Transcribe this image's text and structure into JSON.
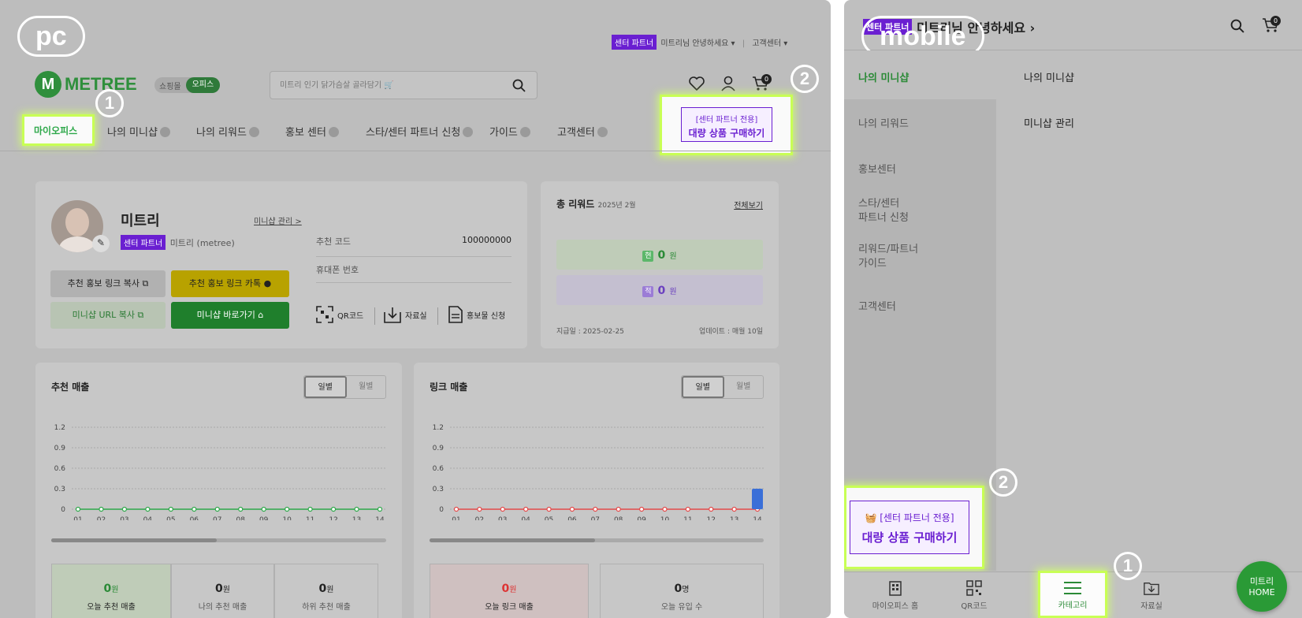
{
  "pc": {
    "tag": "pc",
    "top_bar": {
      "badge": "센터 파트너",
      "greeting": "미트리님 안녕하세요 ▾",
      "customer_center": "고객센터 ▾"
    },
    "logo_text": "METREE",
    "mall_toggle": {
      "shop": "쇼핑몰",
      "office": "오피스"
    },
    "search_placeholder": "미트리 인기 닭가슴살 골라담기 🛒",
    "cart_count": "0",
    "marker1": "1",
    "marker2": "2",
    "nav": [
      "마이오피스",
      "나의 미니샵",
      "나의 리워드",
      "홍보 센터",
      "스타/센터 파트너 신청",
      "가이드",
      "고객센터"
    ],
    "bulk": {
      "line1": "[센터 파트너 전용]",
      "line2": "대량 상품 구매하기"
    },
    "profile": {
      "name": "미트리",
      "manage_link": "미니샵 관리 >",
      "badge": "센터 파트너",
      "sub": "미트리 (metree)",
      "code_label": "추천 코드",
      "code_value": "100000000",
      "phone_label": "휴대폰 번호",
      "buttons": [
        "추천 홍보 링크 복사",
        "추천 홍보 링크 카톡",
        "미니샵 URL 복사",
        "미니샵 바로가기"
      ],
      "shortcuts": [
        "QR코드",
        "자료실",
        "홍보물 신청"
      ]
    },
    "reward": {
      "title": "총 리워드",
      "period": "2025년 2월",
      "all_link": "전체보기",
      "row1_badge": "현",
      "row1_value": "0",
      "row1_unit": "원",
      "row2_badge": "적",
      "row2_value": "0",
      "row2_unit": "원",
      "pay_date": "지급일 : 2025-02-25",
      "update": "업데이트 : 매월 10일"
    },
    "sales_cards": [
      {
        "title": "추천 매출",
        "tabs": [
          "일별",
          "월별"
        ],
        "stats": [
          {
            "value": "0",
            "unit": "원",
            "label": "오늘 추천 매출"
          },
          {
            "value": "0",
            "unit": "원",
            "label": "나의 추천 매출"
          },
          {
            "value": "0",
            "unit": "원",
            "label": "하위 추천 매출"
          }
        ]
      },
      {
        "title": "링크 매출",
        "tabs": [
          "일별",
          "월별"
        ],
        "stats": [
          {
            "value": "0",
            "unit": "원",
            "label": "오늘 링크 매출"
          },
          {
            "value": "0",
            "unit": "명",
            "label": "오늘 유입 수"
          }
        ]
      }
    ]
  },
  "mobile": {
    "tag": "mobile",
    "header": {
      "badge": "센터 파트너",
      "greeting": "미트리님 안녕하세요",
      "cart_count": "0"
    },
    "left_menu": [
      "나의 미니샵",
      "나의 리워드",
      "홍보센터",
      "스타/센터\n파트너 신청",
      "리워드/파트너\n가이드",
      "고객센터"
    ],
    "right_menu": [
      "나의 미니샵",
      "미니샵 관리"
    ],
    "marker1": "1",
    "marker2": "2",
    "bulk": {
      "line1": "[센터 파트너 전용]",
      "line2": "대량 상품 구매하기"
    },
    "bottom_nav": [
      "마이오피스 홈",
      "QR코드",
      "카테고리",
      "자료실"
    ],
    "home_button": {
      "line1": "미트리",
      "line2": "HOME"
    }
  },
  "chart_data": [
    {
      "type": "line",
      "title": "추천 매출",
      "x": [
        "01",
        "02",
        "03",
        "04",
        "05",
        "06",
        "07",
        "08",
        "09",
        "10",
        "11",
        "12",
        "13",
        "14"
      ],
      "yticks": [
        0,
        0.3,
        0.6,
        0.9,
        1.2
      ],
      "ylim": [
        0,
        1.2
      ],
      "series": [
        {
          "values": [
            0,
            0,
            0,
            0,
            0,
            0,
            0,
            0,
            0,
            0,
            0,
            0,
            0,
            0
          ]
        }
      ],
      "color": "#2ea84a"
    },
    {
      "type": "bar+line",
      "title": "링크 매출",
      "x": [
        "01",
        "02",
        "03",
        "04",
        "05",
        "06",
        "07",
        "08",
        "09",
        "10",
        "11",
        "12",
        "13",
        "14"
      ],
      "yticks": [
        0,
        0.3,
        0.6,
        0.9,
        1.2
      ],
      "ylim": [
        0,
        1.2
      ],
      "series": [
        {
          "type": "line",
          "values": [
            0,
            0,
            0,
            0,
            0,
            0,
            0,
            0,
            0,
            0,
            0,
            0,
            0,
            0
          ]
        },
        {
          "type": "bar",
          "values": [
            0,
            0,
            0,
            0,
            0,
            0,
            0,
            0,
            0,
            0,
            0,
            0,
            0,
            0.3
          ]
        }
      ],
      "color": "#e34a4a",
      "bar_color": "#3a6fd8"
    }
  ]
}
